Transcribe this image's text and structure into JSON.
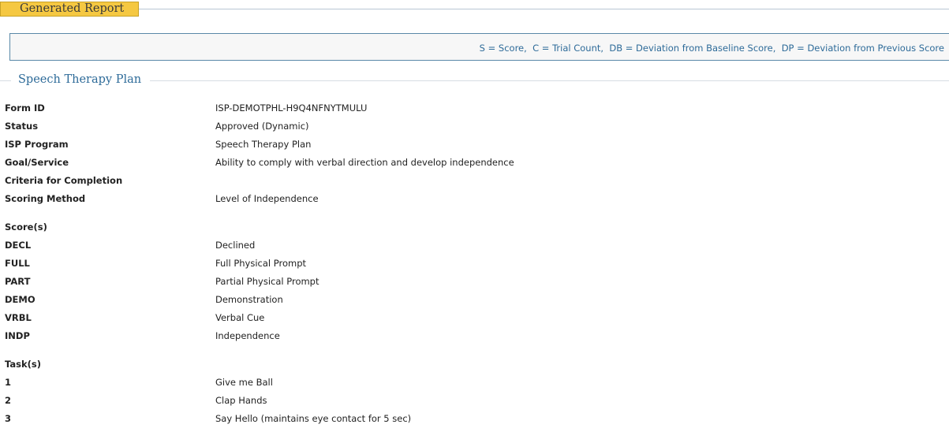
{
  "header": {
    "tab_label": "Generated Report"
  },
  "legend": {
    "text": "S = Score,  C = Trial Count,  DB = Deviation from Baseline Score,  DP = Deviation from Previous Score"
  },
  "section": {
    "title": "Speech Therapy Plan"
  },
  "details": [
    {
      "label": "Form ID",
      "value": "ISP-DEMOTPHL-H9Q4NFNYTMULU"
    },
    {
      "label": "Status",
      "value": "Approved (Dynamic)"
    },
    {
      "label": "ISP Program",
      "value": "Speech Therapy Plan"
    },
    {
      "label": "Goal/Service",
      "value": "Ability to comply with verbal direction and develop independence"
    },
    {
      "label": "Criteria for Completion",
      "value": ""
    },
    {
      "label": "Scoring Method",
      "value": "Level of Independence"
    }
  ],
  "scores": {
    "heading": "Score(s)",
    "items": [
      {
        "code": "DECL",
        "desc": "Declined"
      },
      {
        "code": "FULL",
        "desc": "Full Physical Prompt"
      },
      {
        "code": "PART",
        "desc": "Partial Physical Prompt"
      },
      {
        "code": "DEMO",
        "desc": "Demonstration"
      },
      {
        "code": "VRBL",
        "desc": "Verbal Cue"
      },
      {
        "code": "INDP",
        "desc": "Independence"
      }
    ]
  },
  "tasks": {
    "heading": "Task(s)",
    "items": [
      {
        "num": "1",
        "desc": "Give me Ball"
      },
      {
        "num": "2",
        "desc": "Clap Hands"
      },
      {
        "num": "3",
        "desc": "Say Hello (maintains eye contact for 5 sec)"
      }
    ]
  }
}
